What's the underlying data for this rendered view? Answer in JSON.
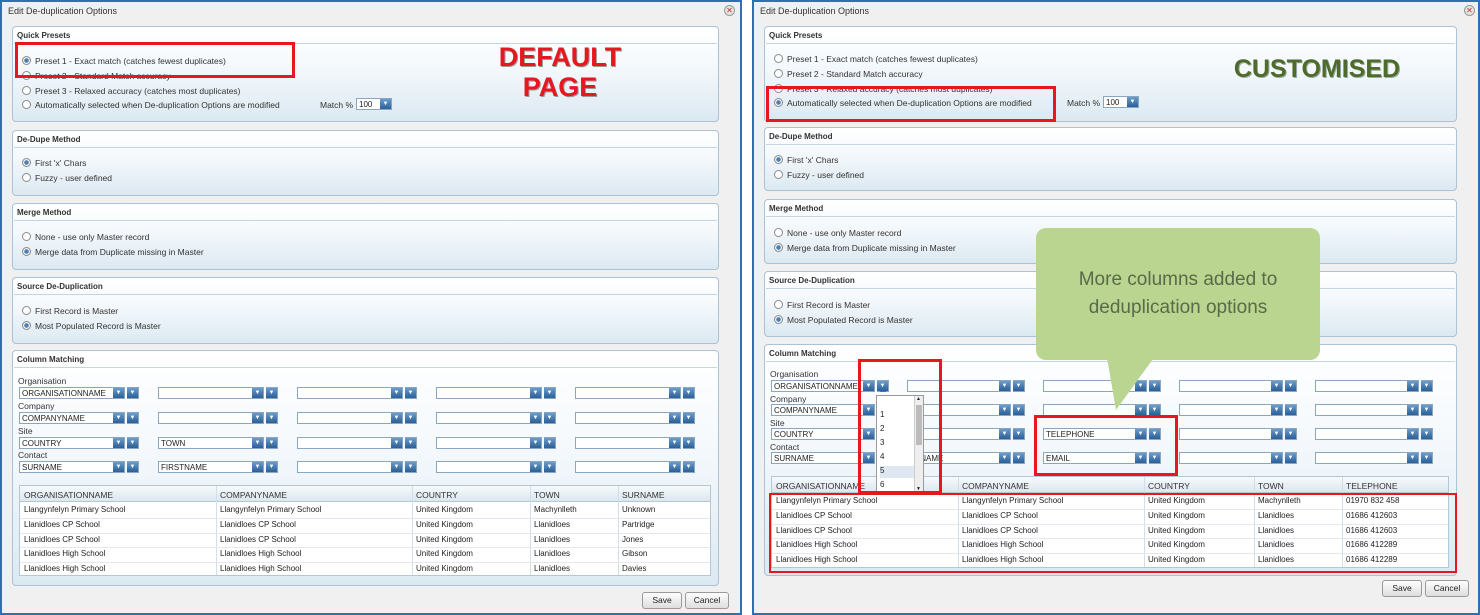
{
  "dialog_title": "Edit De-duplication Options",
  "quick_presets": {
    "header": "Quick Presets",
    "options": [
      "Preset 1 - Exact match (catches fewest duplicates)",
      "Preset 2 - Standard Match accuracy",
      "Preset 3 - Relaxed accuracy (catches most duplicates)",
      "Automatically selected when De-duplication Options are modified"
    ],
    "match_label": "Match %",
    "match_value": "100"
  },
  "dedupe_method": {
    "header": "De-Dupe Method",
    "options": [
      "First 'x' Chars",
      "Fuzzy - user defined"
    ]
  },
  "merge_method": {
    "header": "Merge Method",
    "options": [
      "None - use only Master record",
      "Merge data from Duplicate missing in Master"
    ]
  },
  "source_dedup": {
    "header": "Source De-Duplication",
    "options": [
      "First Record is Master",
      "Most Populated Record is Master"
    ]
  },
  "column_matching": {
    "header": "Column Matching",
    "groups": [
      "Organisation",
      "Company",
      "Site",
      "Contact"
    ],
    "left_fields": {
      "org": "ORGANISATIONNAME",
      "company": "COMPANYNAME",
      "site1": "COUNTRY",
      "site2": "TOWN",
      "contact1": "SURNAME",
      "contact2": "FIRSTNAME"
    },
    "right_fields": {
      "org": "ORGANISATIONNAME",
      "org_num": "5",
      "company": "COMPANYNAME",
      "site1": "COUNTRY",
      "site2": "WN",
      "site3": "TELEPHONE",
      "contact1": "SURNAME",
      "contact2": "STNAME",
      "contact3": "EMAIL"
    },
    "number_list": [
      "1",
      "2",
      "3",
      "4",
      "5",
      "6"
    ]
  },
  "left_grid": {
    "columns": [
      "ORGANISATIONNAME",
      "COMPANYNAME",
      "COUNTRY",
      "TOWN",
      "SURNAME"
    ],
    "rows": [
      [
        "Llangynfelyn Primary School",
        "Llangynfelyn Primary School",
        "United Kingdom",
        "Machynlleth",
        "Unknown"
      ],
      [
        "Llanidloes CP School",
        "Llanidloes CP School",
        "United Kingdom",
        "Llanidloes",
        "Partridge"
      ],
      [
        "Llanidloes CP School",
        "Llanidloes CP School",
        "United Kingdom",
        "Llanidloes",
        "Jones"
      ],
      [
        "Llanidloes High School",
        "Llanidloes High School",
        "United Kingdom",
        "Llanidloes",
        "Gibson"
      ],
      [
        "Llanidloes High School",
        "Llanidloes High School",
        "United Kingdom",
        "Llanidloes",
        "Davies"
      ]
    ]
  },
  "right_grid": {
    "columns": [
      "ORGANISATIONNAME",
      "COMPANYNAME",
      "COUNTRY",
      "TOWN",
      "TELEPHONE"
    ],
    "rows": [
      [
        "Llangynfelyn Primary School",
        "Llangynfelyn Primary School",
        "United Kingdom",
        "Machynlleth",
        "01970 832 458"
      ],
      [
        "Llanidloes CP School",
        "Llanidloes CP School",
        "United Kingdom",
        "Llanidloes",
        "01686 412603"
      ],
      [
        "Llanidloes CP School",
        "Llanidloes CP School",
        "United Kingdom",
        "Llanidloes",
        "01686 412603"
      ],
      [
        "Llanidloes High School",
        "Llanidloes High School",
        "United Kingdom",
        "Llanidloes",
        "01686 412289"
      ],
      [
        "Llanidloes High School",
        "Llanidloes High School",
        "United Kingdom",
        "Llanidloes",
        "01686 412289"
      ]
    ]
  },
  "buttons": {
    "save": "Save",
    "cancel": "Cancel"
  },
  "annotations": {
    "default_line1": "DEFAULT",
    "default_line2": "PAGE",
    "customised": "CUSTOMISED",
    "callout_line1": "More columns added to",
    "callout_line2": "deduplication options"
  },
  "colors": {
    "highlight": "#e8161e",
    "default_text": "#e8161e",
    "customised_text": "#4e6b2a",
    "callout_bg": "#b9d58f",
    "dialog_border": "#2f6fb5"
  }
}
